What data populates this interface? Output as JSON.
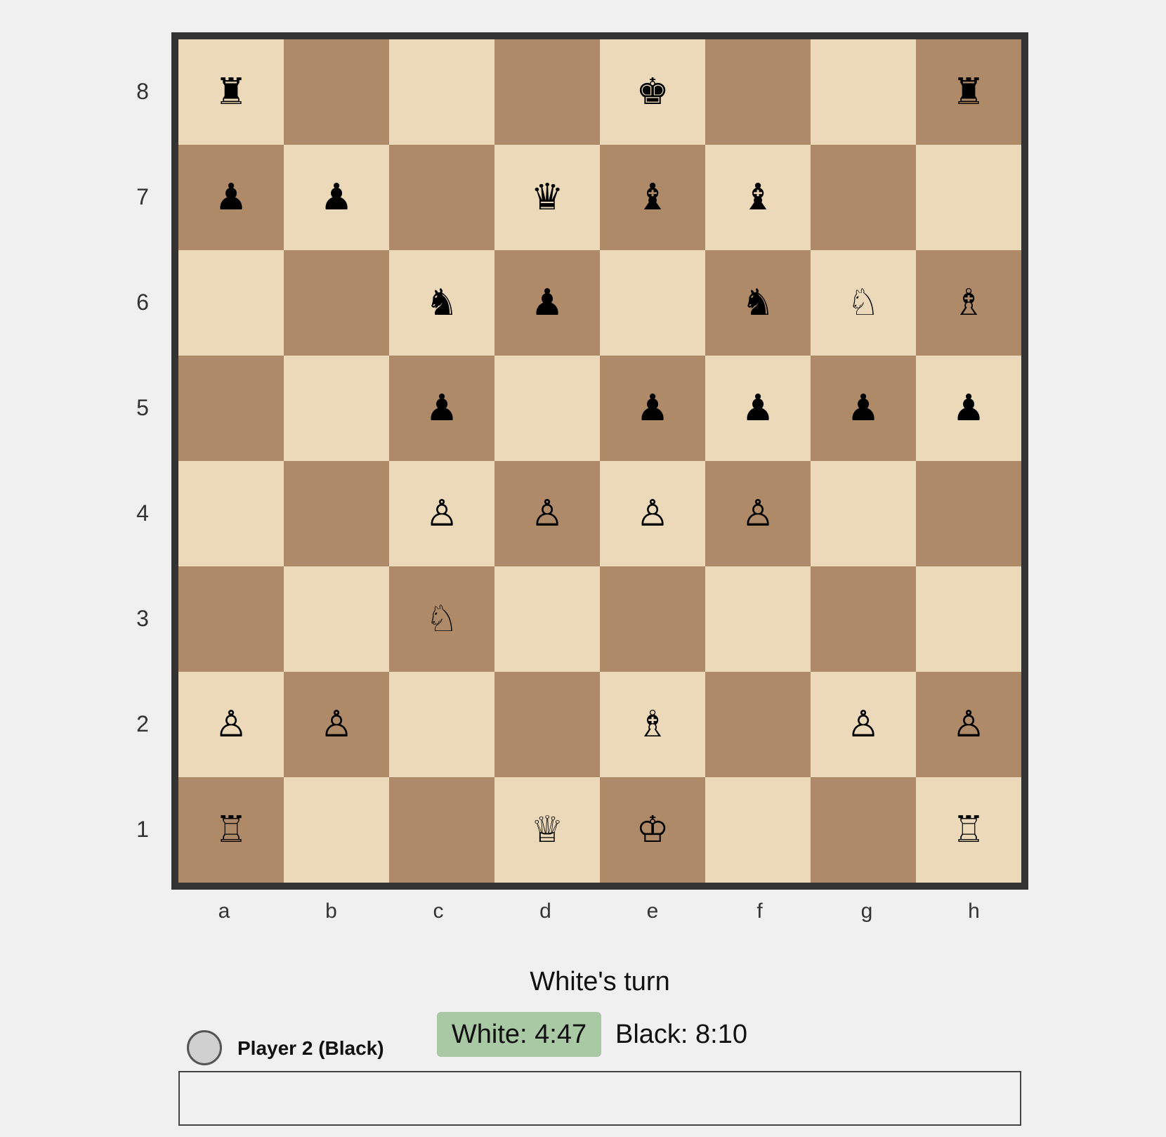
{
  "board": {
    "ranks": [
      "8",
      "7",
      "6",
      "5",
      "4",
      "3",
      "2",
      "1"
    ],
    "files": [
      "a",
      "b",
      "c",
      "d",
      "e",
      "f",
      "g",
      "h"
    ],
    "colors": {
      "light": "#ecd9b9",
      "dark": "#ae8a69",
      "frame": "#333333"
    },
    "position": [
      [
        "♜",
        "",
        "",
        "",
        "♚",
        "",
        "",
        "♜"
      ],
      [
        "♟",
        "♟",
        "",
        "♛",
        "♝",
        "♝",
        "",
        ""
      ],
      [
        "",
        "",
        "♞",
        "♟",
        "",
        "♞",
        "♘",
        "♗"
      ],
      [
        "",
        "",
        "♟",
        "",
        "♟",
        "♟",
        "♟",
        "♟"
      ],
      [
        "",
        "",
        "♙",
        "♙",
        "♙",
        "♙",
        "",
        ""
      ],
      [
        "",
        "",
        "♘",
        "",
        "",
        "",
        "",
        ""
      ],
      [
        "♙",
        "♙",
        "",
        "",
        "♗",
        "",
        "♙",
        "♙"
      ],
      [
        "♖",
        "",
        "",
        "♕",
        "♔",
        "",
        "",
        "♖"
      ]
    ]
  },
  "status": {
    "turn_text": "White's turn",
    "white_clock": "White: 4:47",
    "black_clock": "Black: 8:10",
    "active_clock_color": "#a9c8a4"
  },
  "player": {
    "name": "Player 2 (Black)"
  },
  "chat": {
    "value": ""
  }
}
